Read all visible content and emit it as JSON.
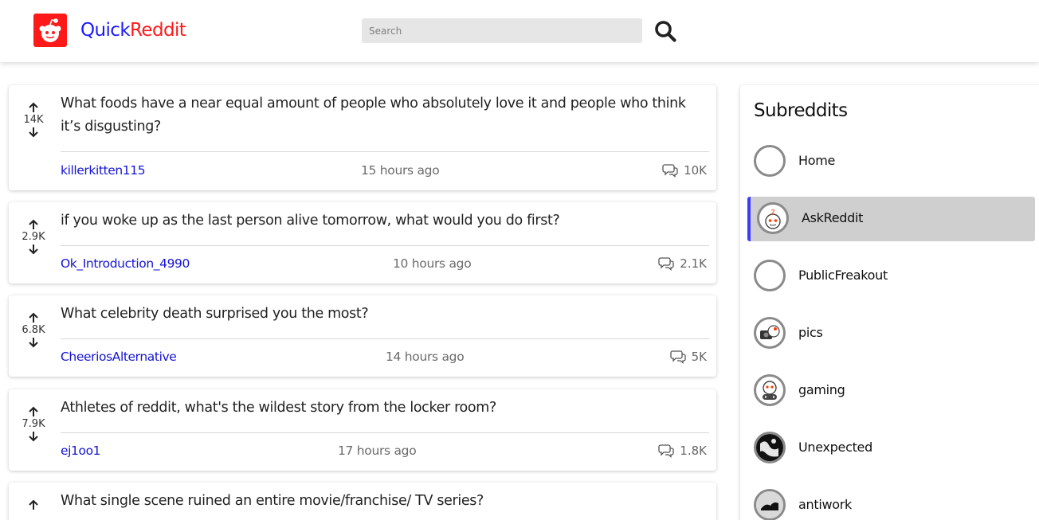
{
  "header": {
    "brand_part1": "Quick",
    "brand_part2": "Reddit",
    "search_placeholder": "Search",
    "logo_icon": "reddit-alien-icon",
    "search_icon": "search-icon"
  },
  "colors": {
    "brand_blue": "#1a1aff",
    "brand_red": "#ff1a1a",
    "author_link": "#1414d6",
    "active_bar": "#3b3bff"
  },
  "posts": [
    {
      "score": "14K",
      "title": "What foods have a near equal amount of people who absolutely love it and people who think it’s disgusting?",
      "author": "killerkitten115",
      "time": "15 hours ago",
      "comments": "10K"
    },
    {
      "score": "2.9K",
      "title": "if you woke up as the last person alive tomorrow, what would you do first?",
      "author": "Ok_Introduction_4990",
      "time": "10 hours ago",
      "comments": "2.1K"
    },
    {
      "score": "6.8K",
      "title": "What celebrity death surprised you the most?",
      "author": "CheeriosAlternative",
      "time": "14 hours ago",
      "comments": "5K"
    },
    {
      "score": "7.9K",
      "title": "Athletes of reddit, what's the wildest story from the locker room?",
      "author": "ej1oo1",
      "time": "17 hours ago",
      "comments": "1.8K"
    },
    {
      "score": "",
      "title": "What single scene ruined an entire movie/franchise/ TV series?",
      "author": "",
      "time": "",
      "comments": ""
    }
  ],
  "sidebar": {
    "title": "Subreddits",
    "items": [
      {
        "label": "Home",
        "icon": "empty-circle-icon",
        "active": false
      },
      {
        "label": "AskReddit",
        "icon": "askreddit-snoo-icon",
        "active": true
      },
      {
        "label": "PublicFreakout",
        "icon": "empty-circle-icon",
        "active": false
      },
      {
        "label": "pics",
        "icon": "camera-snoo-icon",
        "active": false
      },
      {
        "label": "gaming",
        "icon": "gaming-snoo-icon",
        "active": false
      },
      {
        "label": "Unexpected",
        "icon": "unexpected-icon",
        "active": false
      },
      {
        "label": "antiwork",
        "icon": "antiwork-icon",
        "active": false
      }
    ]
  }
}
